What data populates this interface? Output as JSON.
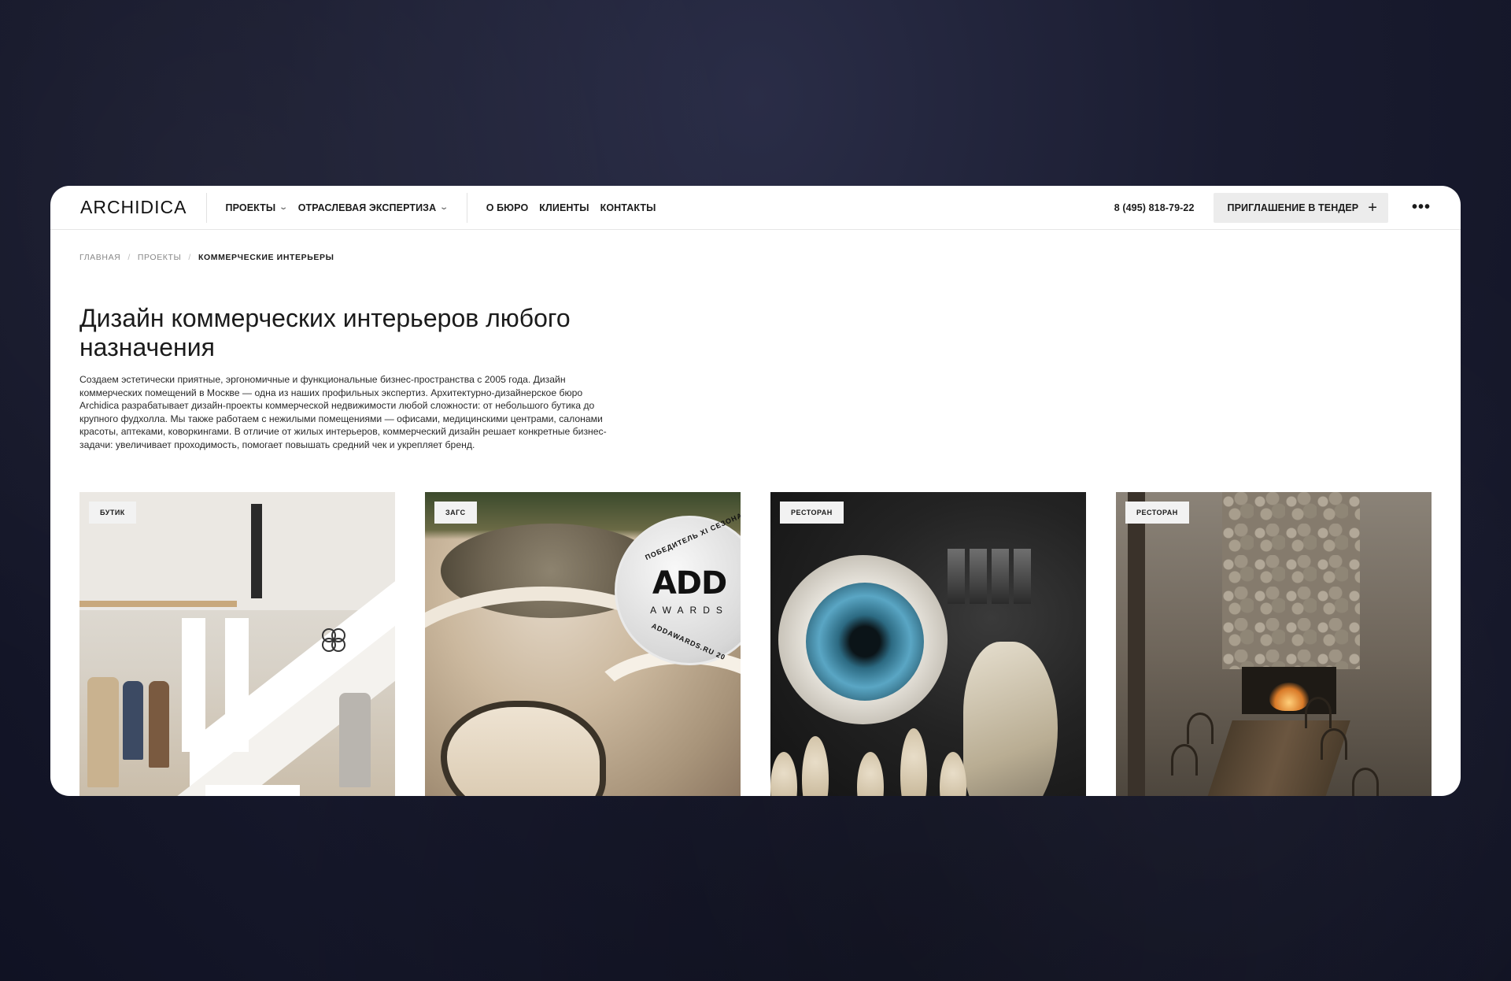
{
  "header": {
    "logo": "ARCHIDICA",
    "nav_primary": [
      {
        "label": "ПРОЕКТЫ",
        "has_dropdown": true
      },
      {
        "label": "ОТРАСЛЕВАЯ ЭКСПЕРТИЗА",
        "has_dropdown": true
      }
    ],
    "nav_secondary": [
      {
        "label": "О БЮРО"
      },
      {
        "label": "КЛИЕНТЫ"
      },
      {
        "label": "КОНТАКТЫ"
      }
    ],
    "phone": "8 (495) 818-79-22",
    "tender_button": "ПРИГЛАШЕНИЕ В ТЕНДЕР",
    "icons": {
      "dropdown": "chevron-down-icon",
      "tender": "plus-icon",
      "more": "more-icon"
    }
  },
  "breadcrumb": [
    {
      "label": "ГЛАВНАЯ"
    },
    {
      "label": "ПРОЕКТЫ"
    },
    {
      "label": "КОММЕРЧЕСКИЕ ИНТЕРЬЕРЫ"
    }
  ],
  "breadcrumb_separator": "/",
  "page": {
    "title": "Дизайн коммерческих интерьеров любого назначения",
    "description": "Создаем эстетически приятные, эргономичные и функциональные бизнес-пространства с 2005 года. Дизайн коммерческих помещений в Москве — одна из наших профильных экспертиз. Архитектурно-дизайнерское бюро Archidica разрабатывает дизайн-проекты коммерческой недвижимости любой сложности: от небольшого бутика до крупного фудхолла. Мы также работаем с нежилыми помещениями — офисами, медицинскими центрами, салонами красоты, аптеками, коворкингами. В отличие от жилых интерьеров, коммерческий дизайн решает конкретные бизнес-задачи: увеличивает проходимость, помогает повышать средний чек и укрепляет бренд."
  },
  "cards": [
    {
      "tag": "БУТИК"
    },
    {
      "tag": "ЗАГС",
      "badge": {
        "top_text": "ПОБЕДИТЕЛЬ XI СЕЗОНА П",
        "logo": "ADD",
        "sub": "AWARDS",
        "bottom_text": "ADDAWARDS.RU 20"
      }
    },
    {
      "tag": "РЕСТОРАН"
    },
    {
      "tag": "РЕСТОРАН"
    }
  ]
}
